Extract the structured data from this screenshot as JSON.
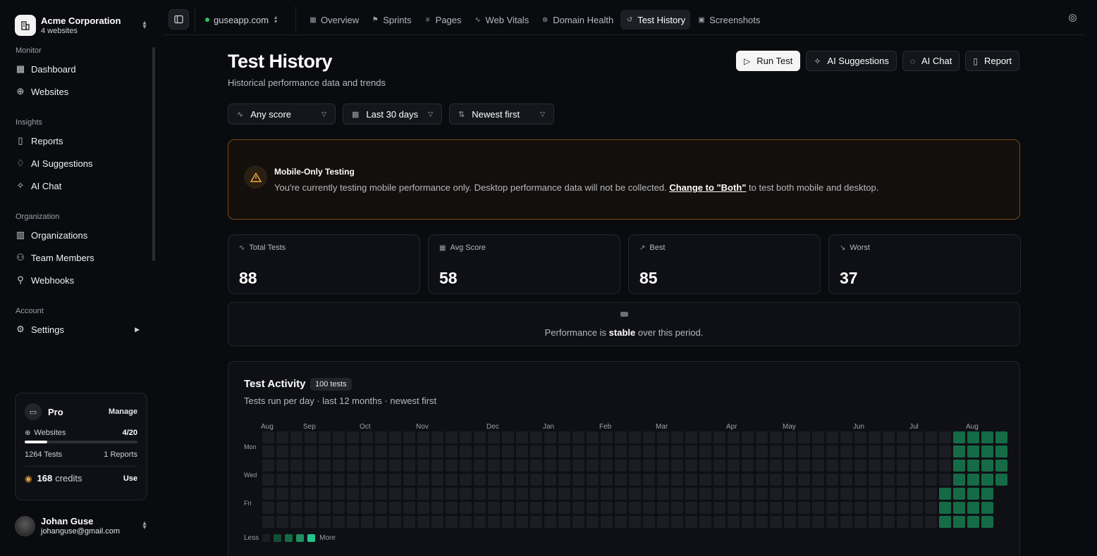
{
  "org": {
    "name": "Acme Corporation",
    "sub": "4 websites"
  },
  "sidebar": {
    "sections": [
      {
        "title": "Monitor",
        "items": [
          {
            "label": "Dashboard",
            "icon": "grid-icon"
          },
          {
            "label": "Websites",
            "icon": "globe-icon"
          }
        ]
      },
      {
        "title": "Insights",
        "items": [
          {
            "label": "Reports",
            "icon": "file-icon"
          },
          {
            "label": "AI Suggestions",
            "icon": "lightbulb-icon"
          },
          {
            "label": "AI Chat",
            "icon": "sparkle-icon"
          }
        ]
      },
      {
        "title": "Organization",
        "items": [
          {
            "label": "Organizations",
            "icon": "building-icon"
          },
          {
            "label": "Team Members",
            "icon": "users-icon"
          },
          {
            "label": "Webhooks",
            "icon": "webhook-icon"
          }
        ]
      },
      {
        "title": "Account",
        "items": [
          {
            "label": "Settings",
            "icon": "gear-icon"
          }
        ]
      }
    ]
  },
  "plan": {
    "name": "Pro",
    "manage": "Manage",
    "websites_label": "Websites",
    "websites_value": "4/20",
    "websites_fraction": 0.2,
    "tests": "1264 Tests",
    "reports": "1 Reports",
    "credits_value": "168",
    "credits_label": "credits",
    "use": "Use"
  },
  "user": {
    "name": "Johan Guse",
    "email": "johanguse@gmail.com"
  },
  "topbar": {
    "site": "guseapp.com",
    "tabs": [
      {
        "label": "Overview",
        "icon": "grid-icon",
        "active": false
      },
      {
        "label": "Sprints",
        "icon": "flag-icon",
        "active": false
      },
      {
        "label": "Pages",
        "icon": "list-icon",
        "active": false
      },
      {
        "label": "Web Vitals",
        "icon": "pulse-icon",
        "active": false
      },
      {
        "label": "Domain Health",
        "icon": "globe-icon",
        "active": false
      },
      {
        "label": "Test History",
        "icon": "history-icon",
        "active": true
      },
      {
        "label": "Screenshots",
        "icon": "image-icon",
        "active": false
      }
    ]
  },
  "page": {
    "title": "Test History",
    "subtitle": "Historical performance data and trends"
  },
  "actions": {
    "run_test": "Run Test",
    "ai_suggestions": "AI Suggestions",
    "ai_chat": "AI Chat",
    "report": "Report"
  },
  "filters": {
    "score": "Any score",
    "range": "Last 30 days",
    "sort": "Newest first"
  },
  "warning": {
    "title": "Mobile-Only Testing",
    "text_before": "You're currently testing mobile performance only. Desktop performance data will not be collected. ",
    "link": "Change to \"Both\"",
    "text_after": " to test both mobile and desktop."
  },
  "stats": [
    {
      "label": "Total Tests",
      "value": "88",
      "icon": "pulse-icon"
    },
    {
      "label": "Avg Score",
      "value": "58",
      "icon": "grid-icon"
    },
    {
      "label": "Best",
      "value": "85",
      "icon": "trend-up-icon"
    },
    {
      "label": "Worst",
      "value": "37",
      "icon": "trend-down-icon"
    }
  ],
  "trend": {
    "before": "Performance is ",
    "word": "stable",
    "after": " over this period."
  },
  "activity": {
    "title": "Test Activity",
    "badge": "100 tests",
    "subtitle": "Tests run per day · last 12 months · newest first",
    "months": [
      "Aug",
      "Sep",
      "Oct",
      "Nov",
      "Dec",
      "Jan",
      "Feb",
      "Mar",
      "Apr",
      "May",
      "Jun",
      "Jul",
      "Aug"
    ],
    "month_week_index": [
      0,
      3,
      7,
      11,
      16,
      20,
      24,
      28,
      33,
      37,
      42,
      46,
      50
    ],
    "day_labels": [
      "Mon",
      "Wed",
      "Fri"
    ],
    "weeks": 53,
    "active_week_start": 49,
    "legend_less": "Less",
    "legend_more": "More",
    "colors": {
      "empty": "#1b1d22",
      "l1": "#134e36",
      "l2": "#166b47",
      "l3": "#1e8f5e",
      "l4": "#22c58a"
    }
  }
}
